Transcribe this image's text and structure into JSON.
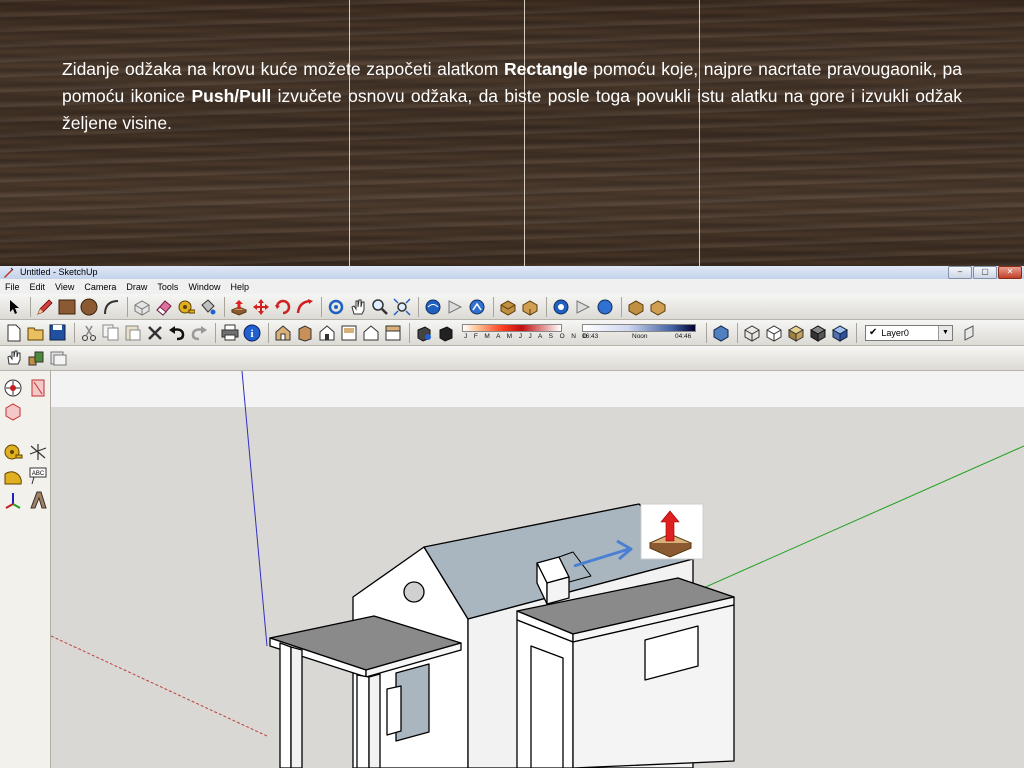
{
  "banner": {
    "text_part1": "Zidanje odžaka na krovu kuće možete započeti alatkom ",
    "bold1": "Rectangle",
    "text_part2": " pomoću koje, najpre nacrtate pravougaonik, pa pomoću ikonice ",
    "bold2": "Push/Pull",
    "text_part3": " izvučete osnovu odžaka, da biste posle toga povukli istu alatku na gore i izvukli odžak željene visine."
  },
  "window": {
    "title": "Untitled - SketchUp"
  },
  "menu": [
    "File",
    "Edit",
    "View",
    "Camera",
    "Draw",
    "Tools",
    "Window",
    "Help"
  ],
  "shadow_settings": {
    "months": "J F M A M J J A S O N D",
    "time_start": "06:43",
    "time_mid": "Noon",
    "time_end": "04:46"
  },
  "layer": {
    "current": "Layer0",
    "check": "✔"
  },
  "colors": {
    "roof": "#a9b6c0",
    "wall": "#ffffff",
    "ground": "#d9d8d4",
    "sky": "#f3f3f3",
    "axis_blue": "#3030c0",
    "axis_green": "#20a020",
    "axis_red": "#c04040",
    "arrow": "#4a7fd4"
  },
  "icons": [
    "select-icon",
    "pencil-icon",
    "rectangle-icon",
    "circle-icon",
    "arc-icon",
    "make-component-icon",
    "eraser-icon",
    "tape-measure-icon",
    "paint-bucket-icon",
    "push-pull-icon",
    "move-icon",
    "rotate-icon",
    "follow-me-icon",
    "orbit-icon",
    "pan-icon",
    "zoom-icon",
    "zoom-extents-icon"
  ]
}
